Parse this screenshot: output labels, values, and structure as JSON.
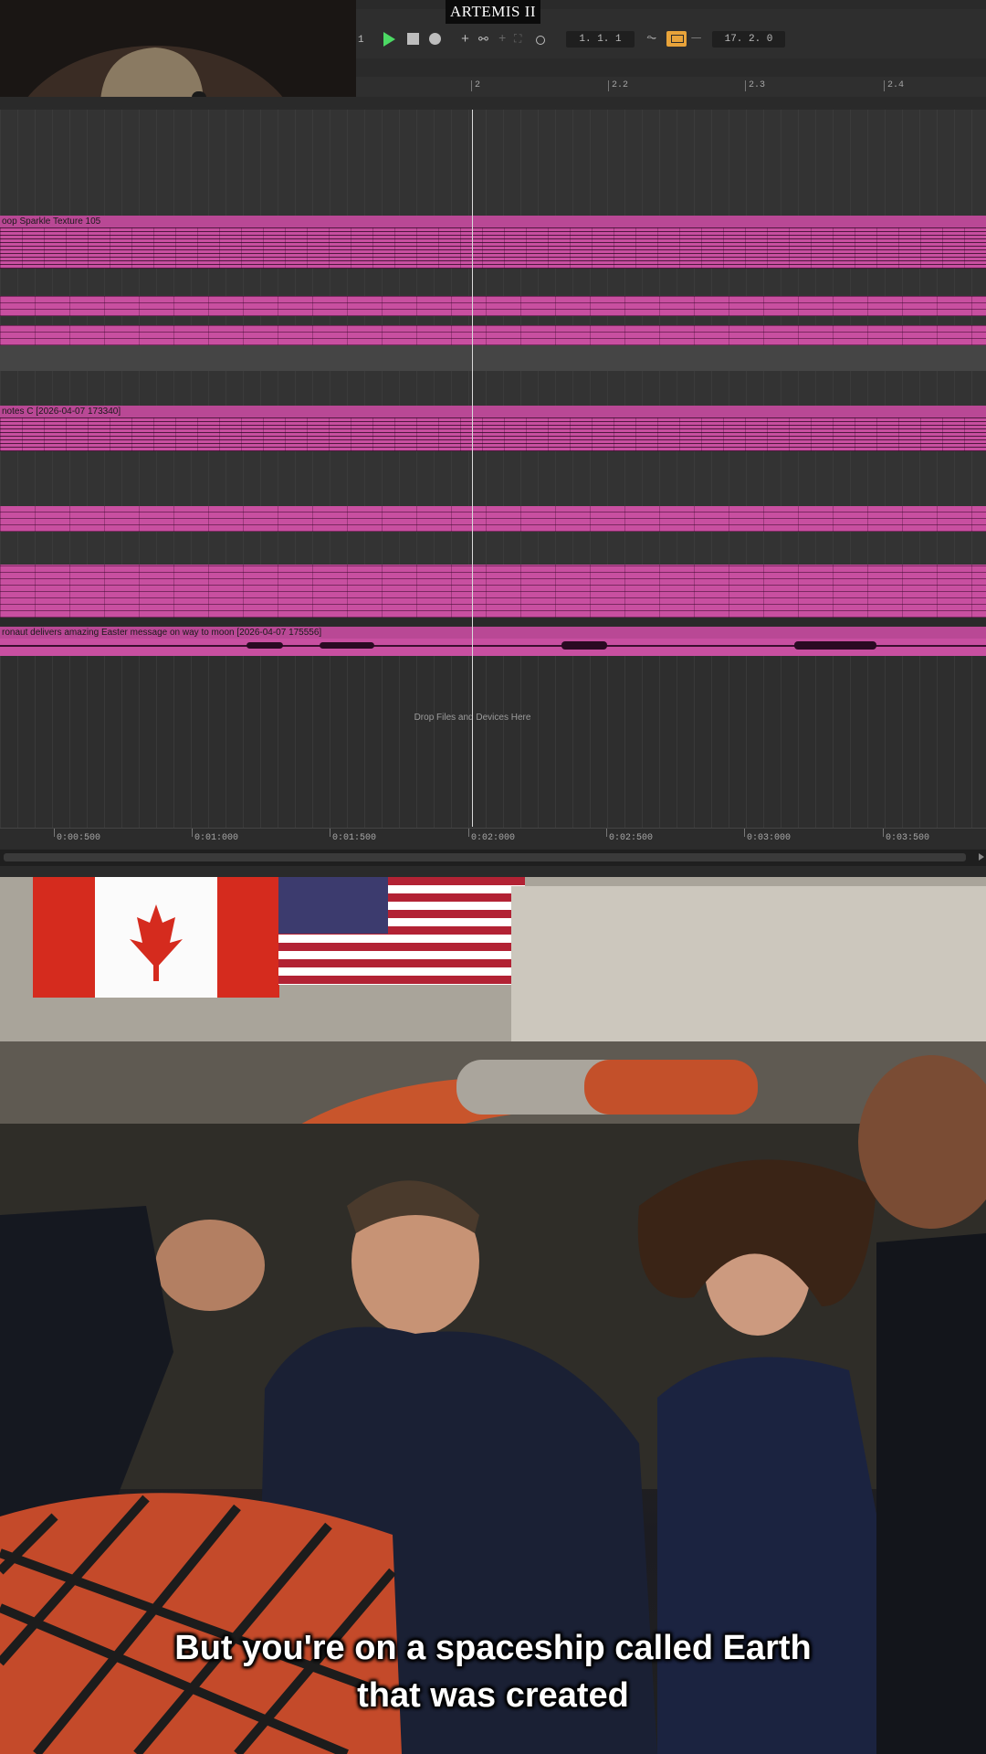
{
  "title": "ARTEMIS II",
  "toolbar": {
    "track_number": "1",
    "position": "1.   1.   1",
    "loop_length": "17.   2.   0",
    "loop_active_color": "#e8a33a",
    "play_color": "#4cd964"
  },
  "ruler": {
    "marks": [
      "2",
      "2.2",
      "2.3",
      "2.4"
    ]
  },
  "tracks": [
    {
      "name": "oop  Sparkle  Texture  105"
    },
    {
      "name": "notes  C [2026-04-07 173340]"
    },
    {
      "name": "ronaut delivers amazing Easter message on way to moon [2026-04-07 175556]"
    }
  ],
  "drop_hint": "Drop Files and Devices Here",
  "time_ruler": [
    "0:00:500",
    "0:01:000",
    "0:01:500",
    "0:02:000",
    "0:02:500",
    "0:03:000",
    "0:03:500"
  ],
  "clip_color": "#c84fa0",
  "subtitle": {
    "line1": "But you're on a spaceship called Earth",
    "line2": "that was created"
  }
}
